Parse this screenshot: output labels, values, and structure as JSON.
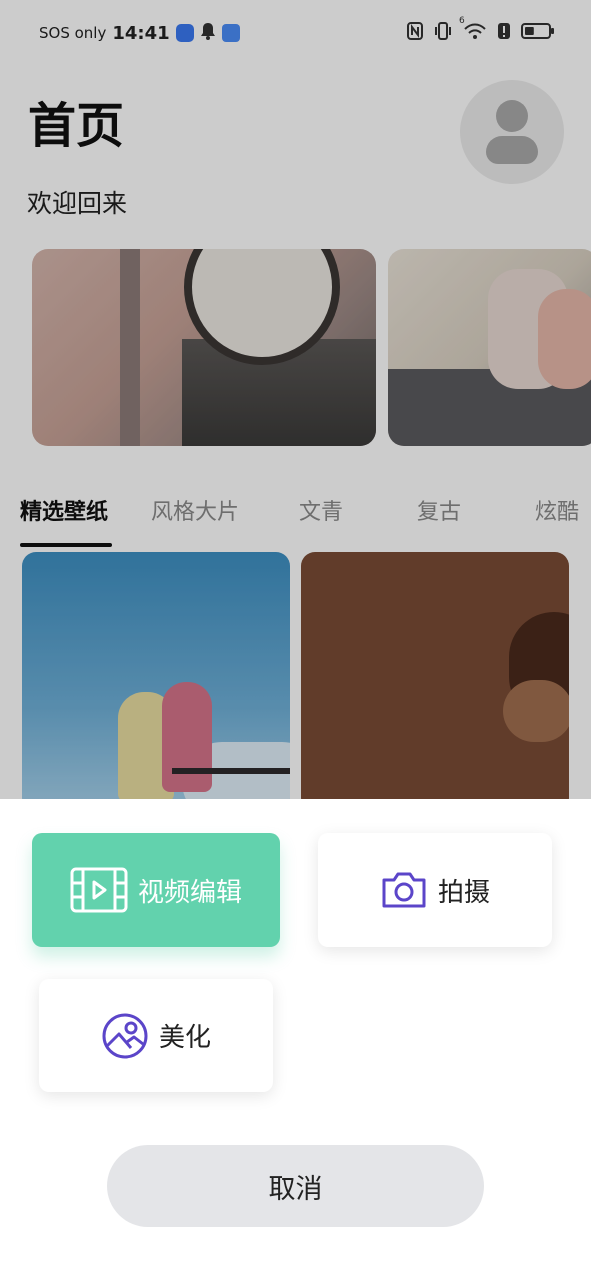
{
  "status_bar": {
    "carrier": "SOS only",
    "time": "14:41",
    "wifi_badge": "6",
    "battery_level": 0.4
  },
  "home": {
    "title": "首页",
    "welcome": "欢迎回来"
  },
  "tabs": [
    "精选壁纸",
    "风格大片",
    "文青",
    "复古",
    "炫酷"
  ],
  "active_tab": "精选壁纸",
  "sheet": {
    "video_edit_label": "视频编辑",
    "shoot_label": "拍摄",
    "beautify_label": "美化",
    "cancel_label": "取消"
  },
  "colors": {
    "accent_green": "#62d2ad",
    "icon_purple": "#5b45c9",
    "cancel_bg": "#e4e5e8"
  },
  "icons": {
    "video_edit": "film-strip-icon",
    "shoot": "camera-icon",
    "beautify": "image-landscape-icon",
    "avatar": "user-silhouette-icon"
  }
}
